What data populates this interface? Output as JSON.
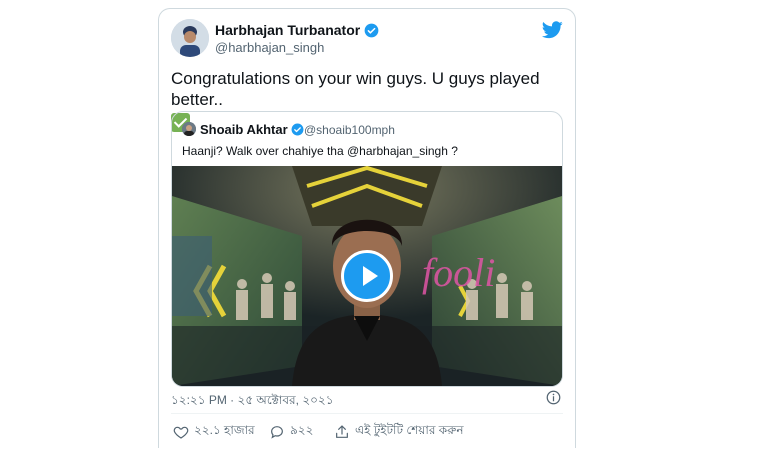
{
  "tweet": {
    "author_name": "Harbhajan Turbanator",
    "author_handle": "@harbhajan_singh",
    "text": "Congratulations on your win guys. U guys played better..",
    "timestamp": "১২:২১ PM · ২৫ অক্টোবর, ২০২১"
  },
  "quoted_tweet": {
    "author_name": "Shoaib Akhtar",
    "author_handle": "@shoaib100mph",
    "text": "Haanji? Walk over chahiye tha @harbhajan_singh ?"
  },
  "actions": {
    "likes": "২২.১ হাজার",
    "replies": "৯২২",
    "share": "এই টুইটটি শেয়ার করুন"
  },
  "colors": {
    "accent": "#1d9bf0",
    "text": "#0f1419",
    "secondary": "#536471",
    "border": "#cfd9de"
  },
  "icons": [
    "verified-badge-icon",
    "twitter-bird-icon",
    "check-mark-emoji",
    "play-icon",
    "info-icon",
    "heart-icon",
    "reply-icon",
    "share-icon"
  ]
}
